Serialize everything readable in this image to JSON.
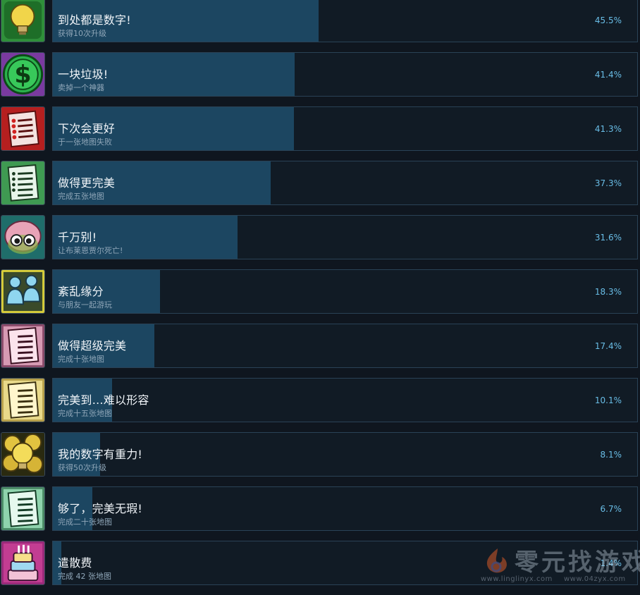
{
  "achievements": [
    {
      "name": "到处都是数字!",
      "desc": "获得10次升级",
      "pct": "45.5%",
      "percent": 45.5,
      "icon": "lightbulb-icon"
    },
    {
      "name": "一块垃圾!",
      "desc": "卖掉一个神器",
      "pct": "41.4%",
      "percent": 41.4,
      "icon": "dollar-coin-icon"
    },
    {
      "name": "下次会更好",
      "desc": "于一张地图失败",
      "pct": "41.3%",
      "percent": 41.3,
      "icon": "failed-scroll-icon"
    },
    {
      "name": "做得更完美",
      "desc": "完成五张地图",
      "pct": "37.3%",
      "percent": 37.3,
      "icon": "green-checklist-icon"
    },
    {
      "name": "千万别!",
      "desc": "让布莱恩贾尔死亡!",
      "pct": "31.6%",
      "percent": 31.6,
      "icon": "brain-creature-icon"
    },
    {
      "name": "紊乱缘分",
      "desc": "与朋友一起游玩",
      "pct": "18.3%",
      "percent": 18.3,
      "icon": "two-players-icon"
    },
    {
      "name": "做得超级完美",
      "desc": "完成十张地图",
      "pct": "17.4%",
      "percent": 17.4,
      "icon": "pink-checklist-icon"
    },
    {
      "name": "完美到…难以形容",
      "desc": "完成十五张地图",
      "pct": "10.1%",
      "percent": 10.1,
      "icon": "yellow-checklist-icon"
    },
    {
      "name": "我的数字有重力!",
      "desc": "获得50次升级",
      "pct": "8.1%",
      "percent": 8.1,
      "icon": "lightbulb-cluster-icon"
    },
    {
      "name": "够了，完美无瑕!",
      "desc": "完成二十张地图",
      "pct": "6.7%",
      "percent": 6.7,
      "icon": "mint-checklist-icon"
    },
    {
      "name": "遣散费",
      "desc": "完成 42 张地图",
      "pct": "1.4%",
      "percent": 1.4,
      "icon": "cake-icon"
    }
  ],
  "watermark": {
    "title": "零元找游戏",
    "url_left": "www.linglinyx.com",
    "url_right": "www.04zyx.com"
  },
  "colors": {
    "background": "#0f161f",
    "bar_fill": "#1c4661",
    "percent_text": "#69bde6"
  }
}
